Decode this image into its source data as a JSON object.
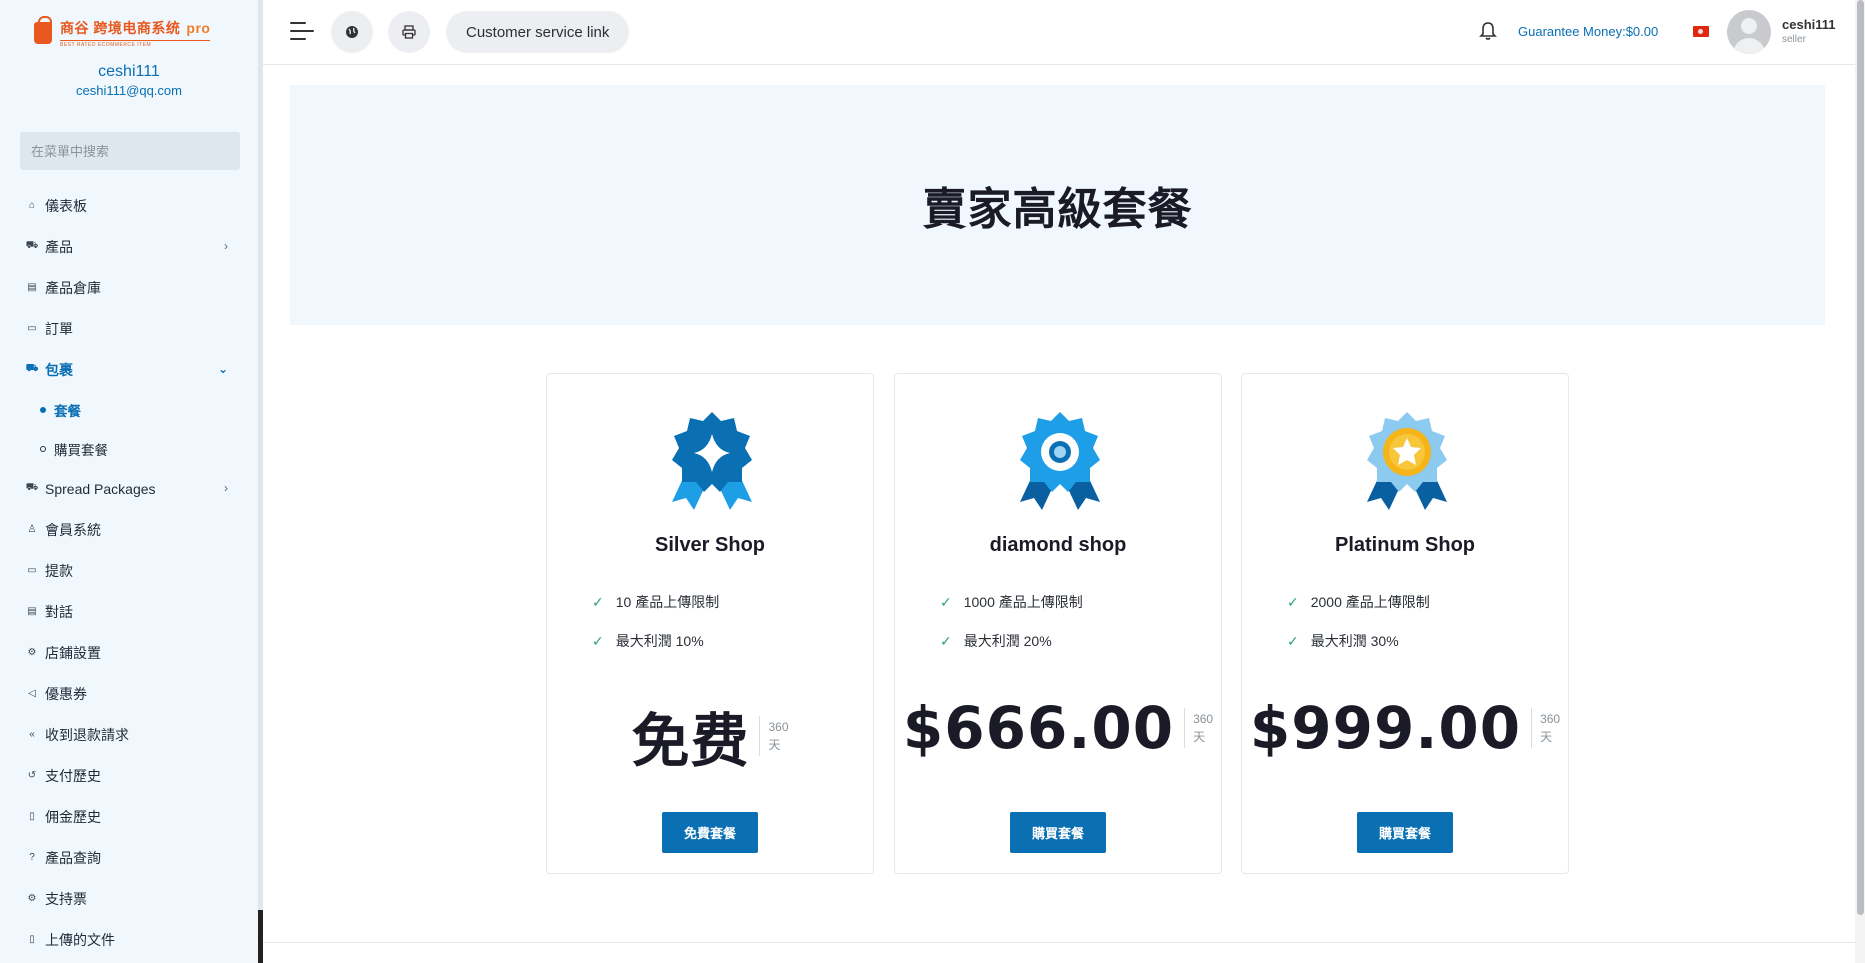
{
  "brand": {
    "logo_text": "商谷 跨境电商系统",
    "logo_pro": "pro",
    "logo_tagline": "BEST RATED ECOMMERCE ITEM"
  },
  "sidebar": {
    "user_name": "ceshi111",
    "user_email": "ceshi111@qq.com",
    "search_placeholder": "在菜單中搜索",
    "items": [
      {
        "label": "儀表板",
        "icon": "home-icon"
      },
      {
        "label": "產品",
        "icon": "cart-icon",
        "has_children": true
      },
      {
        "label": "產品倉庫",
        "icon": "warehouse-icon"
      },
      {
        "label": "訂單",
        "icon": "order-icon"
      },
      {
        "label": "包裹",
        "icon": "package-icon",
        "expanded": true
      },
      {
        "label": "Spread Packages",
        "icon": "cart-icon",
        "has_children": true
      },
      {
        "label": "會員系統",
        "icon": "user-icon"
      },
      {
        "label": "提款",
        "icon": "withdraw-icon"
      },
      {
        "label": "對話",
        "icon": "chat-icon"
      },
      {
        "label": "店鋪設置",
        "icon": "gear-icon"
      },
      {
        "label": "優惠券",
        "icon": "megaphone-icon"
      },
      {
        "label": "收到退款請求",
        "icon": "refund-icon"
      },
      {
        "label": "支付歷史",
        "icon": "history-icon"
      },
      {
        "label": "佣金歷史",
        "icon": "file-icon"
      },
      {
        "label": "產品查詢",
        "icon": "question-icon"
      },
      {
        "label": "支持票",
        "icon": "support-icon"
      },
      {
        "label": "上傳的文件",
        "icon": "upload-file-icon"
      }
    ],
    "subitems": [
      {
        "label": "套餐",
        "active": true
      },
      {
        "label": "購買套餐",
        "active": false
      }
    ]
  },
  "topbar": {
    "customer_service_label": "Customer service link",
    "guarantee_label": "Guarantee Money:",
    "guarantee_value": "$0.00",
    "username": "ceshi111",
    "role": "seller"
  },
  "hero": {
    "title": "賣家高級套餐"
  },
  "packages": [
    {
      "name": "Silver Shop",
      "features": [
        "10 產品上傳限制",
        "最大利潤 10%"
      ],
      "price": "免费",
      "period_value": "360",
      "period_unit": "天",
      "button": "免費套餐"
    },
    {
      "name": "diamond shop",
      "features": [
        "1000 產品上傳限制",
        "最大利潤 20%"
      ],
      "price": "$666.00",
      "period_value": "360",
      "period_unit": "天",
      "button": "購買套餐"
    },
    {
      "name": "Platinum Shop",
      "features": [
        "2000 產品上傳限制",
        "最大利潤 30%"
      ],
      "price": "$999.00",
      "period_value": "360",
      "period_unit": "天",
      "button": "購買套餐"
    }
  ],
  "colors": {
    "accent": "#0a6fb3",
    "sidebar_bg": "#f0f8fe",
    "check": "#2aa56b"
  }
}
